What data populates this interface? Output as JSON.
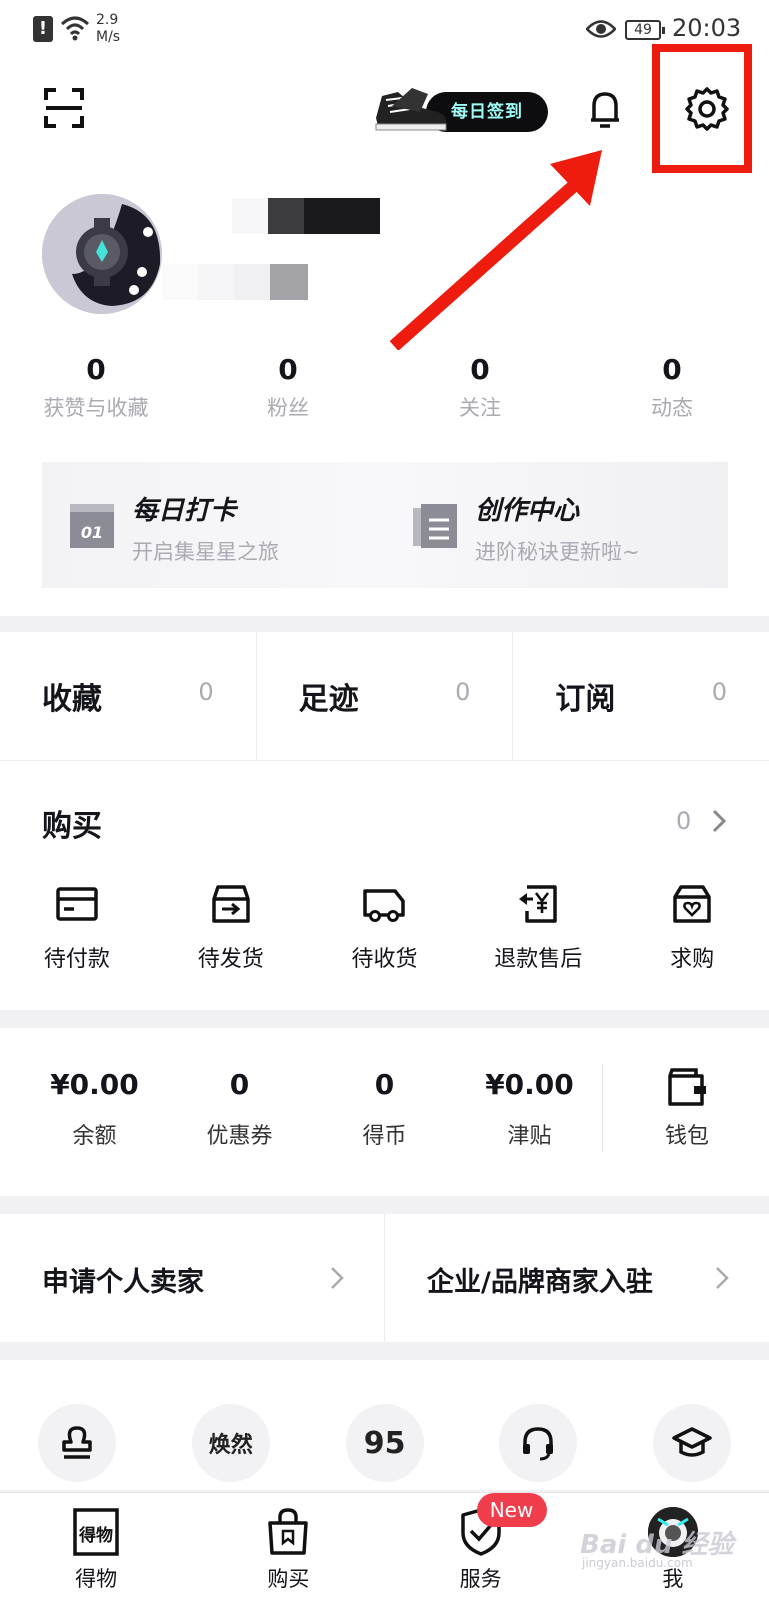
{
  "status_bar": {
    "network_speed_line1": "2.9",
    "network_speed_line2": "M/s",
    "battery": "49",
    "time": "20:03"
  },
  "header": {
    "checkin_label": "每日签到",
    "icons": [
      "scan-icon",
      "bell-icon",
      "gear-icon"
    ]
  },
  "stats": [
    {
      "value": "0",
      "label": "获赞与收藏"
    },
    {
      "value": "0",
      "label": "粉丝"
    },
    {
      "value": "0",
      "label": "关注"
    },
    {
      "value": "0",
      "label": "动态"
    }
  ],
  "features": [
    {
      "title": "每日打卡",
      "subtitle": "开启集星星之旅",
      "icon_text": "01"
    },
    {
      "title": "创作中心",
      "subtitle": "进阶秘诀更新啦~"
    }
  ],
  "collect": [
    {
      "label": "收藏",
      "count": "0"
    },
    {
      "label": "足迹",
      "count": "0"
    },
    {
      "label": "订阅",
      "count": "0"
    }
  ],
  "purchase": {
    "title": "购买",
    "count": "0",
    "orders": [
      {
        "label": "待付款",
        "icon": "card-icon"
      },
      {
        "label": "待发货",
        "icon": "box-icon"
      },
      {
        "label": "待收货",
        "icon": "truck-icon"
      },
      {
        "label": "退款售后",
        "icon": "refund-icon"
      },
      {
        "label": "求购",
        "icon": "bag-heart-icon"
      }
    ]
  },
  "wallet": {
    "items": [
      {
        "value": "¥0.00",
        "label": "余额"
      },
      {
        "value": "0",
        "label": "优惠券"
      },
      {
        "value": "0",
        "label": "得币"
      },
      {
        "value": "¥0.00",
        "label": "津贴"
      }
    ],
    "button_label": "钱包"
  },
  "seller": [
    {
      "label": "申请个人卖家"
    },
    {
      "label": "企业/品牌商家入驻"
    }
  ],
  "tools": [
    {
      "icon": "stamp-icon",
      "text": ""
    },
    {
      "icon": "huanran-icon",
      "text": "焕然"
    },
    {
      "icon": "95-icon",
      "text": "95"
    },
    {
      "icon": "headset-icon",
      "text": ""
    },
    {
      "icon": "graduation-cap-icon",
      "text": ""
    }
  ],
  "bottom_nav": [
    {
      "label": "得物",
      "icon": "dewu-logo-icon",
      "icon_text": "得物"
    },
    {
      "label": "购买",
      "icon": "shopping-bag-icon"
    },
    {
      "label": "服务",
      "icon": "shield-icon",
      "badge": "New"
    },
    {
      "label": "我",
      "icon": "avatar-icon"
    }
  ],
  "watermark": {
    "text": "Bai du 经验",
    "sub": "jingyan.baidu.com"
  }
}
